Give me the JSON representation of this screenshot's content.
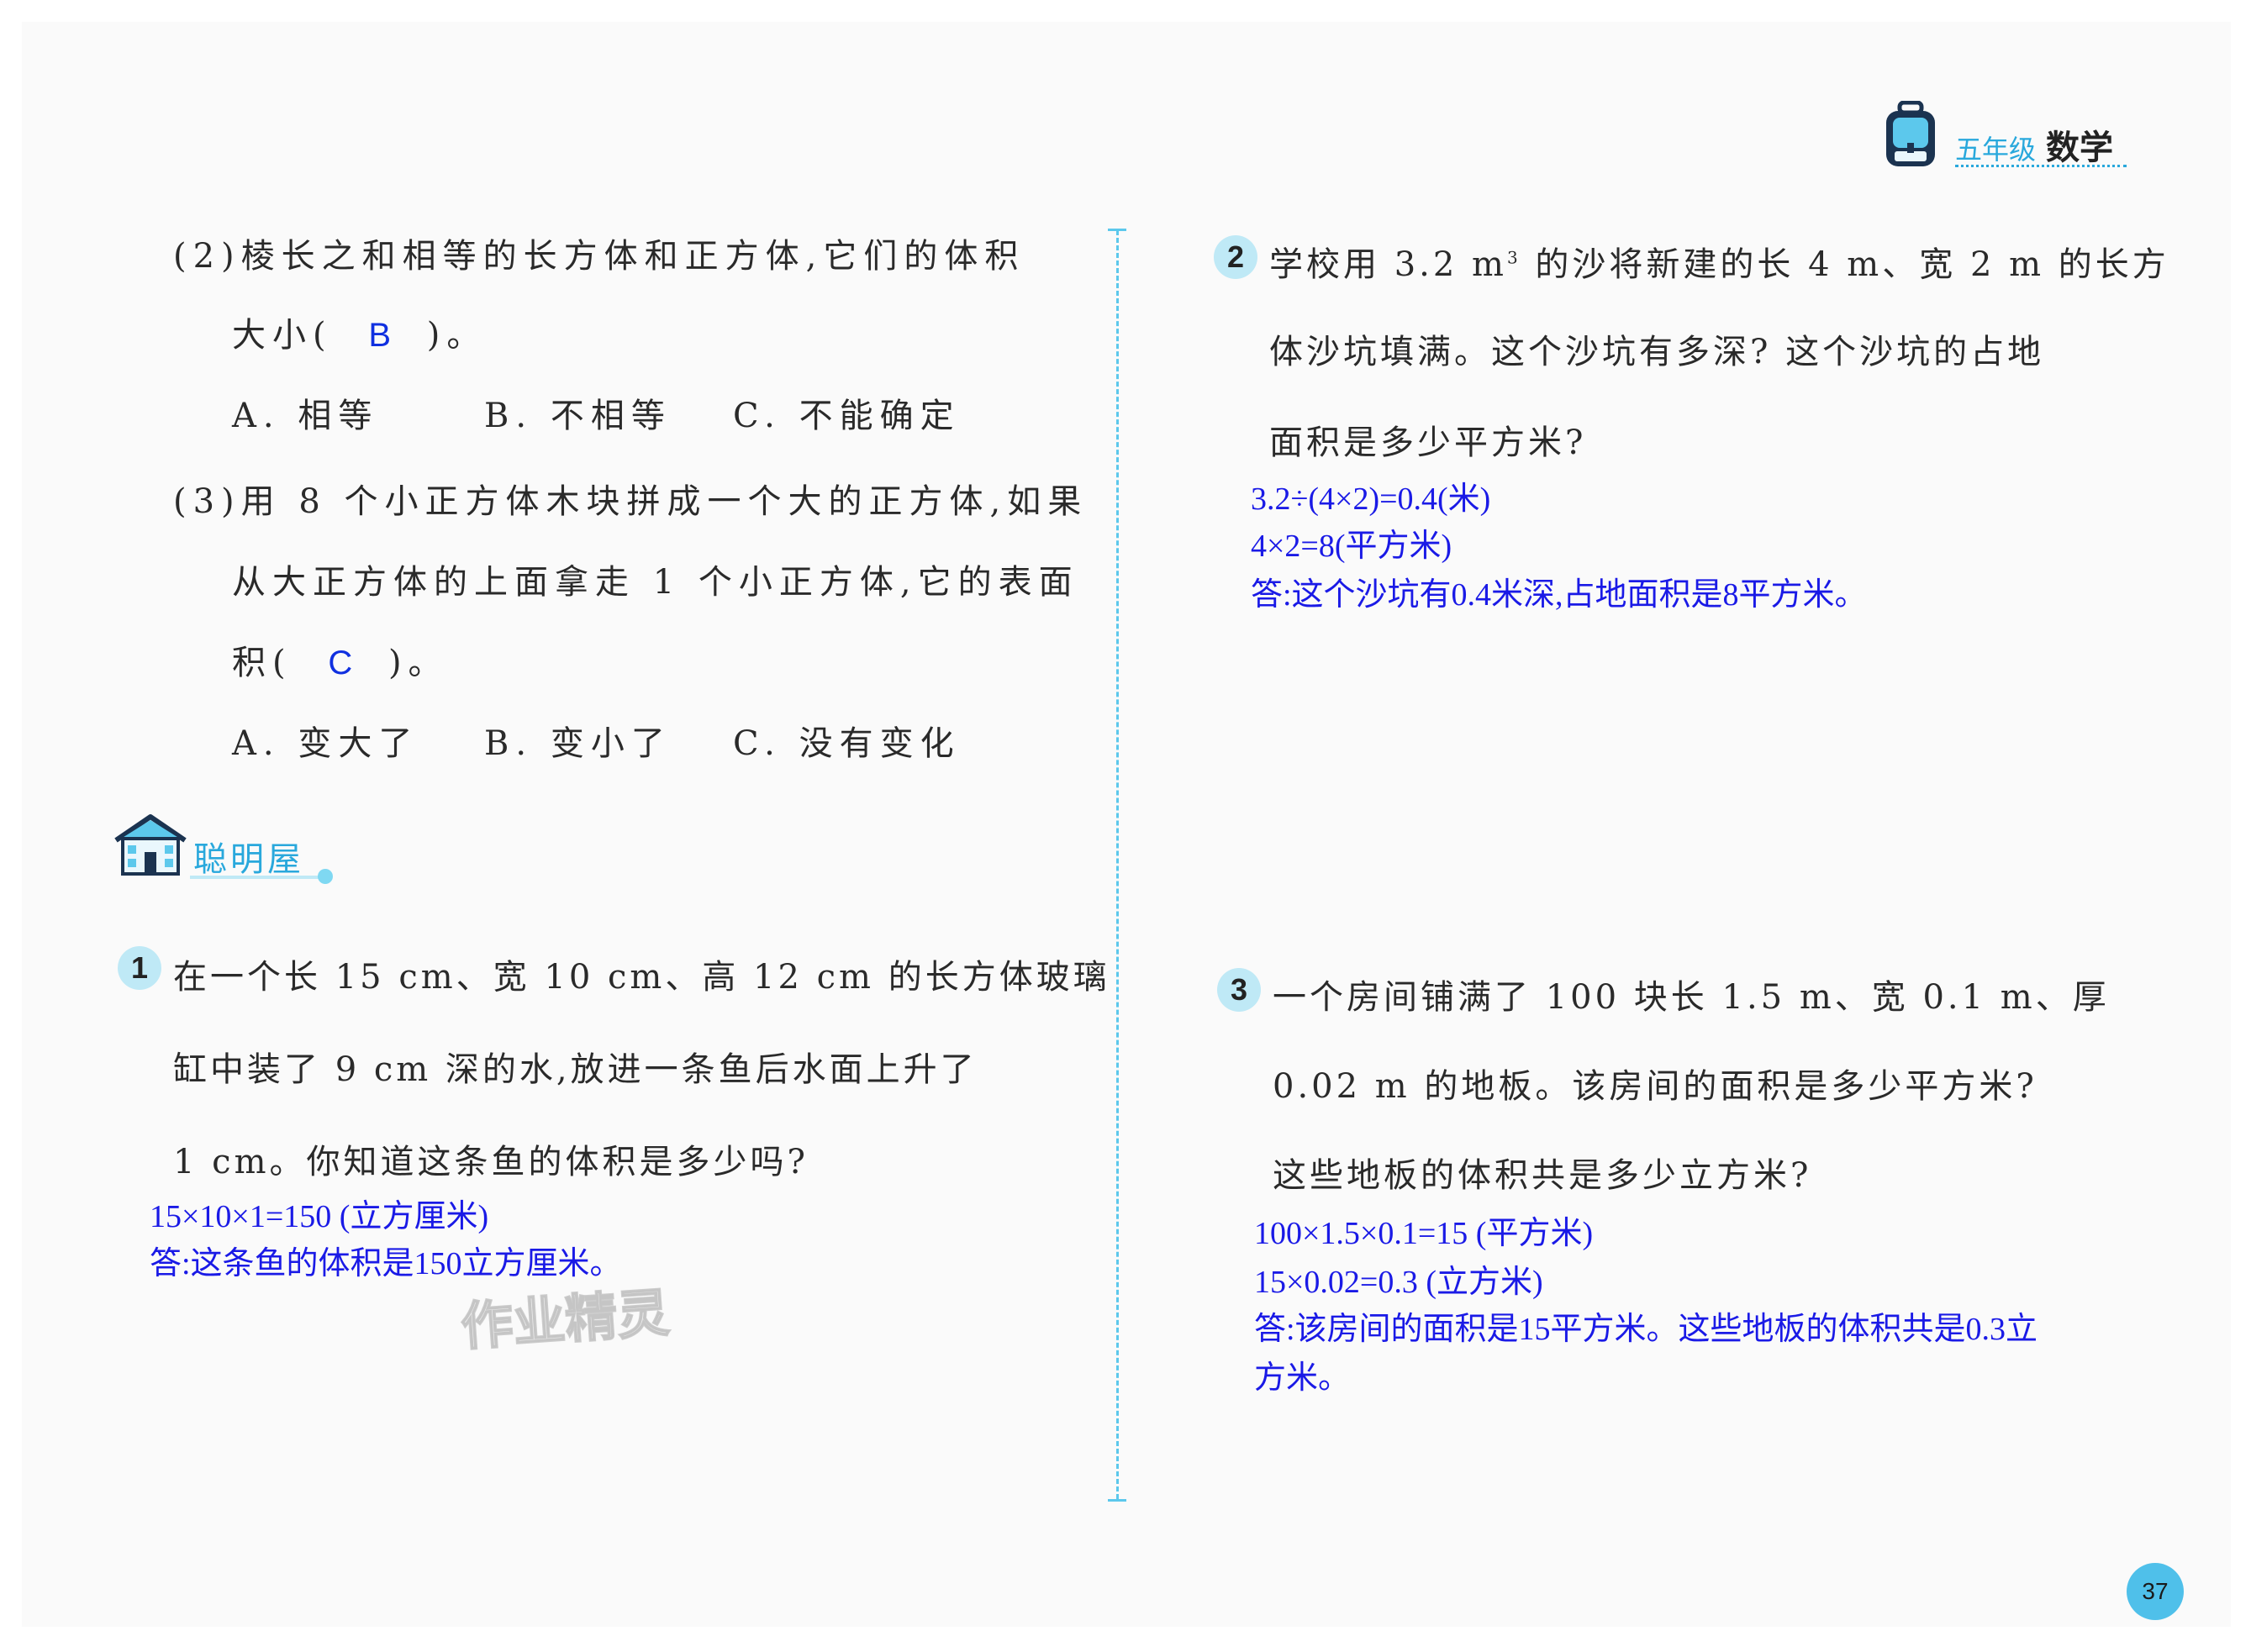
{
  "header": {
    "grade": "五年级",
    "subject": "数学"
  },
  "left": {
    "q2": {
      "line1": "(2)棱长之和相等的长方体和正方体,它们的体积",
      "line2_pre": "大小(",
      "answer": "B",
      "line2_post": ")。",
      "options": [
        "A. 相等",
        "B. 不相等",
        "C. 不能确定"
      ]
    },
    "q3": {
      "line1": "(3)用 8 个小正方体木块拼成一个大的正方体,如果",
      "line2": "从大正方体的上面拿走 1 个小正方体,它的表面",
      "line3_pre": "积(",
      "answer": "C",
      "line3_post": ")。",
      "options": [
        "A. 变大了",
        "B. 变小了",
        "C. 没有变化"
      ]
    }
  },
  "section": {
    "title": "聪明屋"
  },
  "p1": {
    "number": "1",
    "lines": [
      "在一个长 15 cm、宽 10 cm、高 12 cm 的长方体玻璃",
      "缸中装了 9 cm 深的水,放进一条鱼后水面上升了",
      "1 cm。你知道这条鱼的体积是多少吗?"
    ],
    "solution": [
      "15×10×1=150 (立方厘米)",
      "答:这条鱼的体积是150立方厘米。"
    ]
  },
  "p2": {
    "number": "2",
    "line1_pre": "学校用 3.2 m",
    "line1_sup": "3",
    "line1_post": " 的沙将新建的长 4 m、宽 2 m 的长方",
    "lines": [
      "体沙坑填满。这个沙坑有多深? 这个沙坑的占地",
      "面积是多少平方米?"
    ],
    "solution": [
      "3.2÷(4×2)=0.4(米)",
      "4×2=8(平方米)",
      "答:这个沙坑有0.4米深,占地面积是8平方米。"
    ]
  },
  "p3": {
    "number": "3",
    "lines": [
      "一个房间铺满了 100 块长 1.5 m、宽 0.1 m、厚",
      "0.02 m 的地板。该房间的面积是多少平方米?",
      "这些地板的体积共是多少立方米?"
    ],
    "solution": [
      "100×1.5×0.1=15 (平方米)",
      "15×0.02=0.3 (立方米)",
      "答:该房间的面积是15平方米。这些地板的体积共是0.3立",
      "方米。"
    ]
  },
  "page_number": "37",
  "watermark": "作业精灵"
}
